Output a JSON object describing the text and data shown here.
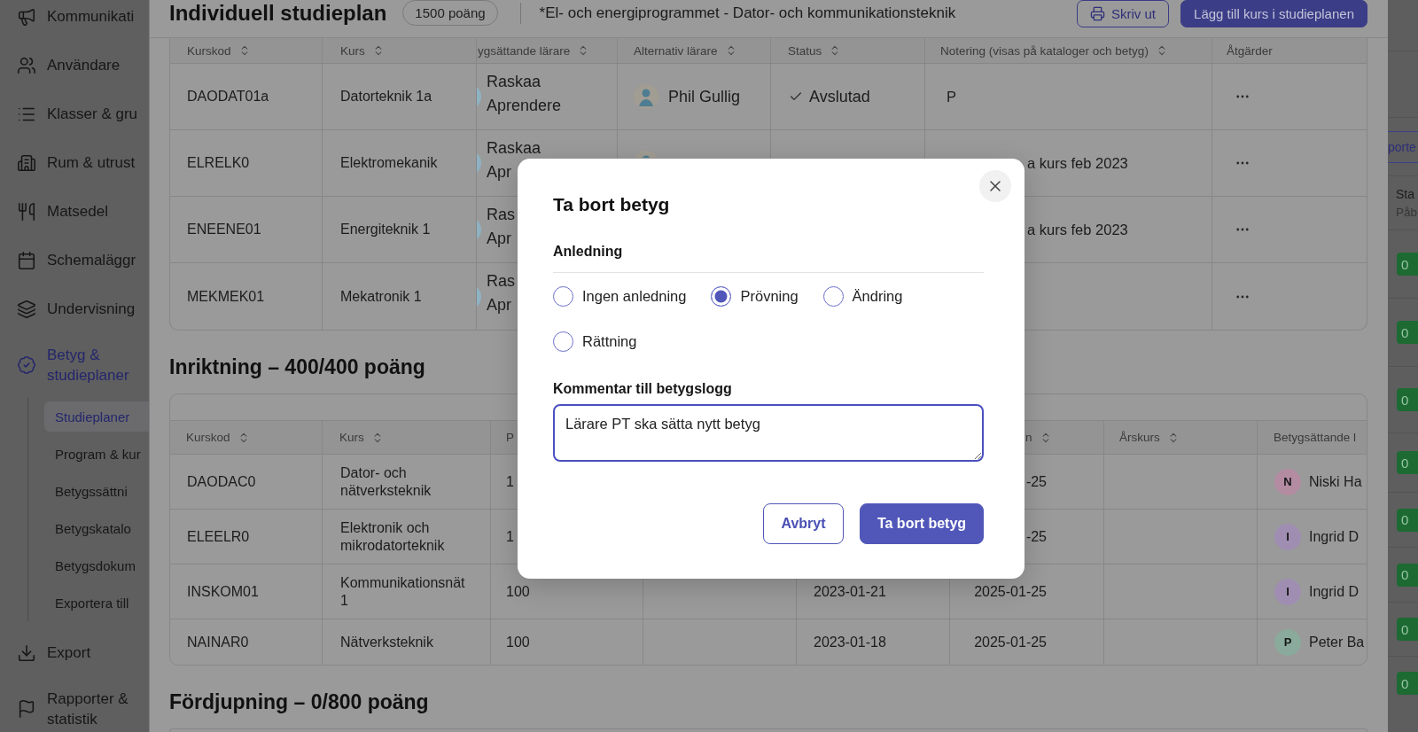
{
  "sidebar": {
    "items": [
      {
        "label": "Kommunikati",
        "selected": false
      },
      {
        "label": "Användare",
        "selected": false
      },
      {
        "label": "Klasser & gru",
        "selected": false
      },
      {
        "label": "Rum & utrust",
        "selected": false
      },
      {
        "label": "Matsedel",
        "selected": false
      },
      {
        "label": "Schemaläggr",
        "selected": false
      },
      {
        "label": "Undervisning",
        "selected": false
      },
      {
        "label": "Betyg & studieplaner",
        "selected": true,
        "children": [
          {
            "label": "Studieplaner",
            "selected": true
          },
          {
            "label": "Program & kur",
            "selected": false
          },
          {
            "label": "Betygssättni",
            "selected": false
          },
          {
            "label": "Betygskatalo",
            "selected": false
          },
          {
            "label": "Betygsdokum",
            "selected": false
          },
          {
            "label": "Exportera till",
            "selected": false
          }
        ]
      },
      {
        "label": "Export",
        "selected": false
      },
      {
        "label": "Rapporter & statistik",
        "selected": false
      }
    ]
  },
  "plan": {
    "title": "Individuell studieplan",
    "points": "1500 poäng",
    "program": "*El- och energiprogrammet - Dator- och kommunikationsteknik",
    "buttons": [
      {
        "label": "Skriv ut",
        "kind": "outline"
      },
      {
        "label": "Lägg till kurs i studieplanen",
        "kind": "primary"
      }
    ],
    "course_table": {
      "columns": [
        {
          "label": "Kurskod",
          "sortable": true
        },
        {
          "label": "Kurs",
          "sortable": true
        },
        {
          "label": "ygsättande lärare",
          "sortable": true
        },
        {
          "label": "Alternativ lärare",
          "sortable": true
        },
        {
          "label": "Status",
          "sortable": true
        },
        {
          "label": "Notering (visas på kataloger och betyg)",
          "sortable": true
        },
        {
          "label": "Åtgärder",
          "sortable": false
        }
      ],
      "rows": [
        {
          "code": "DAODAT01a",
          "course": "Datorteknik 1a",
          "grader": [
            "Raskaa",
            "Aprendere"
          ],
          "alt_teacher": {
            "avatar": true,
            "name": "Phil Gullig"
          },
          "status": "Avslutad",
          "note": "P"
        },
        {
          "code": "ELRELK0",
          "course": "Elektromekanik",
          "grader": [
            "Raskaa",
            "Apr"
          ],
          "alt_teacher": {
            "avatar": true
          },
          "note": "a kurs feb 2023"
        },
        {
          "code": "ENEENE01",
          "course": "Energiteknik 1",
          "grader": [
            "Ras",
            "Apr"
          ],
          "note": "a kurs feb 2023"
        },
        {
          "code": "MEKMEK01",
          "course": "Mekatronik 1",
          "grader": [
            "Ras",
            "Apr"
          ]
        }
      ]
    },
    "sections": [
      {
        "heading": "Inriktning – 400/400 poäng",
        "table": {
          "columns": [
            {
              "label": "Kurskod",
              "sortable": true
            },
            {
              "label": "Kurs",
              "sortable": true
            },
            {
              "label": "P",
              "sortable": false
            },
            null,
            null,
            {
              "label": "n",
              "sortable": true
            },
            {
              "label": "Årskurs",
              "sortable": true
            },
            {
              "label": "Betygsättande l",
              "sortable": false
            }
          ],
          "rows": [
            [
              "DAODAC0",
              "Dator- och nätverksteknik",
              "1",
              null,
              null,
              "-25",
              null,
              {
                "initial": "N",
                "name": "Niski Ha",
                "color": "#b38ca2"
              }
            ],
            [
              "ELEELR0",
              "Elektronik och mikrodatorteknik",
              "1",
              null,
              null,
              "-25",
              null,
              {
                "initial": "I",
                "name": "Ingrid D",
                "color": "#9f8eb2"
              }
            ],
            [
              "INSKOM01",
              "Kommunikationsnät 1",
              "100",
              null,
              "2023-01-21",
              "2025-01-25",
              null,
              {
                "initial": "I",
                "name": "Ingrid D",
                "color": "#9f8eb2"
              }
            ],
            [
              "NAINAR0",
              "Nätverksteknik",
              "100",
              null,
              "2023-01-18",
              "2025-01-25",
              null,
              {
                "initial": "P",
                "name": "Peter Ba",
                "color": "#8aab9c"
              }
            ]
          ]
        }
      },
      {
        "heading": "Fördjupning – 0/800 poäng"
      }
    ]
  },
  "dialog": {
    "title": "Ta bort betyg",
    "reason": {
      "label": "Anledning",
      "options": [
        {
          "label": "Ingen anledning",
          "selected": false
        },
        {
          "label": "Prövning",
          "selected": true
        },
        {
          "label": "Ändring",
          "selected": false
        },
        {
          "label": "Rättning",
          "selected": false
        }
      ]
    },
    "comment": {
      "label": "Kommentar till betygslogg",
      "value": "Lärare PT ska sätta nytt betyg"
    },
    "buttons": [
      {
        "label": "Avbryt",
        "kind": "secondary"
      },
      {
        "label": "Ta bort betyg",
        "kind": "primary"
      }
    ]
  },
  "background_page": {
    "button": "porte",
    "column_header": {
      "title": "Sta",
      "subtitle": "Påb"
    },
    "badges": [
      "0",
      "0",
      "0",
      "0",
      "0",
      "0",
      "0",
      "0"
    ]
  }
}
